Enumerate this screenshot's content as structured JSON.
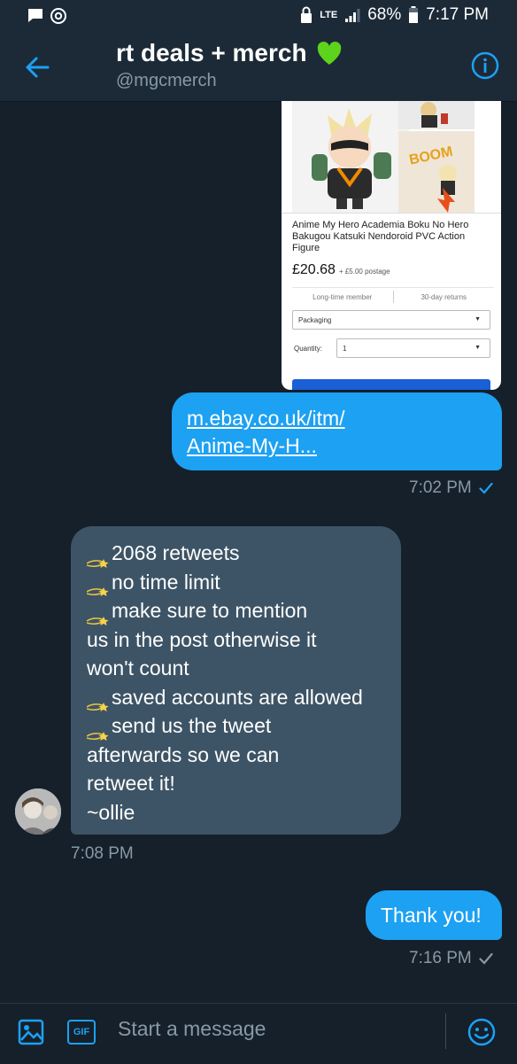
{
  "status_bar": {
    "network": "LTE",
    "battery": "68%",
    "time": "7:17 PM"
  },
  "header": {
    "title": "rt deals + merch",
    "title_emoji": "💚",
    "handle": "@mgcmerch",
    "back_icon": "arrow-left-icon",
    "info_icon": "info-icon"
  },
  "link_card": {
    "product_title": "Anime My Hero Academia Boku No Hero Bakugou Katsuki Nendoroid PVC Action Figure",
    "price": "£20.68",
    "postage": "+ £5.00 postage",
    "seller_badge": "Long-time member",
    "returns": "30-day returns",
    "variation_select": "Packaging",
    "quantity_label": "Quantity:",
    "quantity_value": "1"
  },
  "messages": {
    "link_line1": "m.ebay.co.uk/itm/",
    "link_line2": "Anime-My-H...",
    "link_time": "7:02 PM",
    "received_lines": [
      "2068 retweets",
      "no time limit",
      "make sure to mention",
      "us in the post otherwise it",
      "won't count",
      "saved accounts are allowed",
      "send us the tweet",
      "afterwards so we can",
      "retweet it!",
      "~ollie"
    ],
    "received_time": "7:08 PM",
    "reply_text": "Thank you!",
    "reply_time": "7:16 PM"
  },
  "composer": {
    "placeholder": "Start a message",
    "gif_label": "GIF"
  },
  "colors": {
    "background": "#15202b",
    "accent": "#1da1f2",
    "incoming_bubble": "#3d5466"
  }
}
